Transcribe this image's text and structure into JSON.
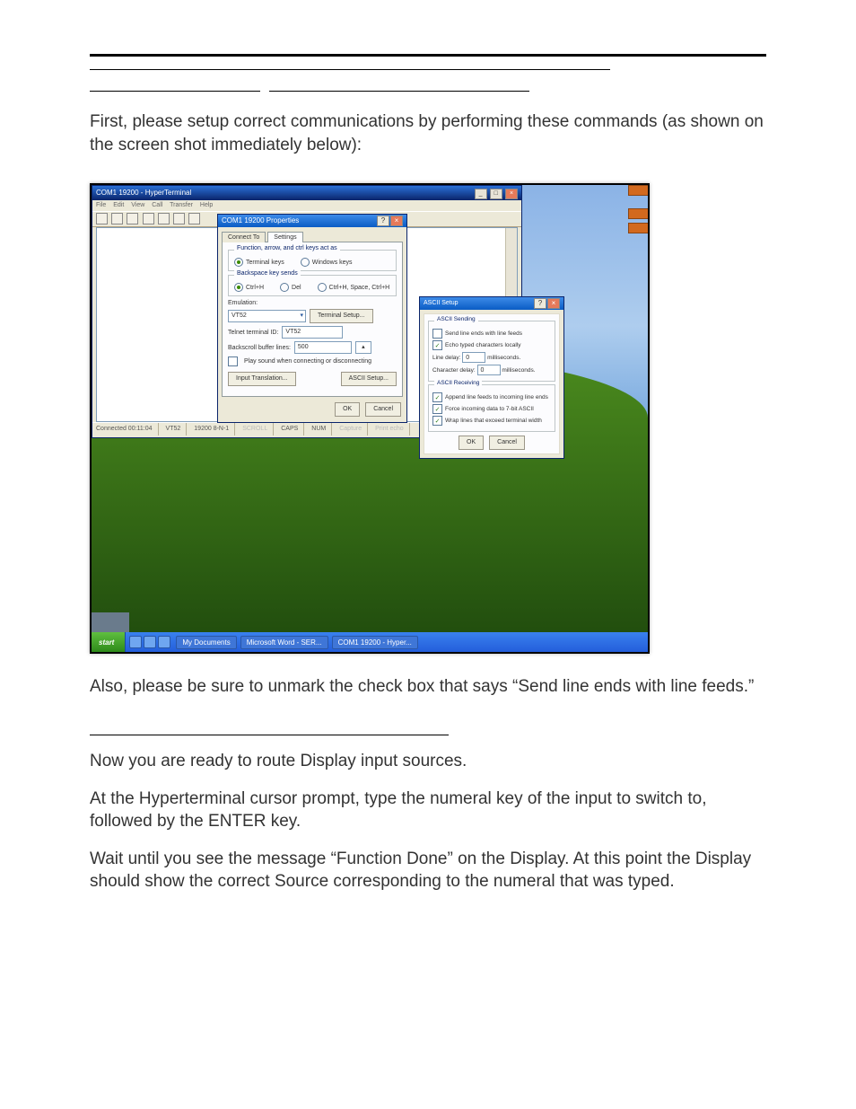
{
  "doc": {
    "p1": "First, please setup correct communications by performing these commands (as shown on the screen shot immediately below):",
    "p2": "Also, please be sure to unmark the check box that says “Send line ends with line feeds.”",
    "p3": "Now you are ready to route Display input sources.",
    "p4": "At the Hyperterminal cursor prompt, type the numeral key of the input to switch to, followed by the ENTER key.",
    "p5": "Wait until you see the message “Function Done” on the Display. At this point the Display should show the correct Source corresponding to the numeral that was typed."
  },
  "ht": {
    "title": "COM1 19200 - HyperTerminal",
    "menu": [
      "File",
      "Edit",
      "View",
      "Call",
      "Transfer",
      "Help"
    ],
    "status": [
      "Connected 00:11:04",
      "VT52",
      "19200 8-N-1",
      "SCROLL",
      "CAPS",
      "NUM",
      "Capture",
      "Print echo"
    ]
  },
  "props": {
    "title": "COM1 19200 Properties",
    "tabs": {
      "connect": "Connect To",
      "settings": "Settings"
    },
    "grp1": "Function, arrow, and ctrl keys act as",
    "r1a": "Terminal keys",
    "r1b": "Windows keys",
    "grp2": "Backspace key sends",
    "r2a": "Ctrl+H",
    "r2b": "Del",
    "r2c": "Ctrl+H, Space, Ctrl+H",
    "emu_label": "Emulation:",
    "emu_value": "VT52",
    "term_setup": "Terminal Setup...",
    "telnet_label": "Telnet terminal ID:",
    "telnet_value": "VT52",
    "backscroll_label": "Backscroll buffer lines:",
    "backscroll_value": "500",
    "playsound": "Play sound when connecting or disconnecting",
    "input_trans": "Input Translation...",
    "ascii_setup": "ASCII Setup...",
    "ok": "OK",
    "cancel": "Cancel"
  },
  "ascii": {
    "title": "ASCII Setup",
    "send_grp": "ASCII Sending",
    "send_line_ends": "Send line ends with line feeds",
    "echo": "Echo typed characters locally",
    "line_delay_l": "Line delay:",
    "line_delay_v": "0",
    "line_delay_u": "milliseconds.",
    "char_delay_l": "Character delay:",
    "char_delay_v": "0",
    "char_delay_u": "milliseconds.",
    "recv_grp": "ASCII Receiving",
    "append": "Append line feeds to incoming line ends",
    "force7": "Force incoming data to 7-bit ASCII",
    "wrap": "Wrap lines that exceed terminal width",
    "ok": "OK",
    "cancel": "Cancel"
  },
  "taskbar": {
    "start": "start",
    "items": [
      "My Documents",
      "Microsoft Word - SER...",
      "COM1 19200 - Hyper..."
    ]
  }
}
